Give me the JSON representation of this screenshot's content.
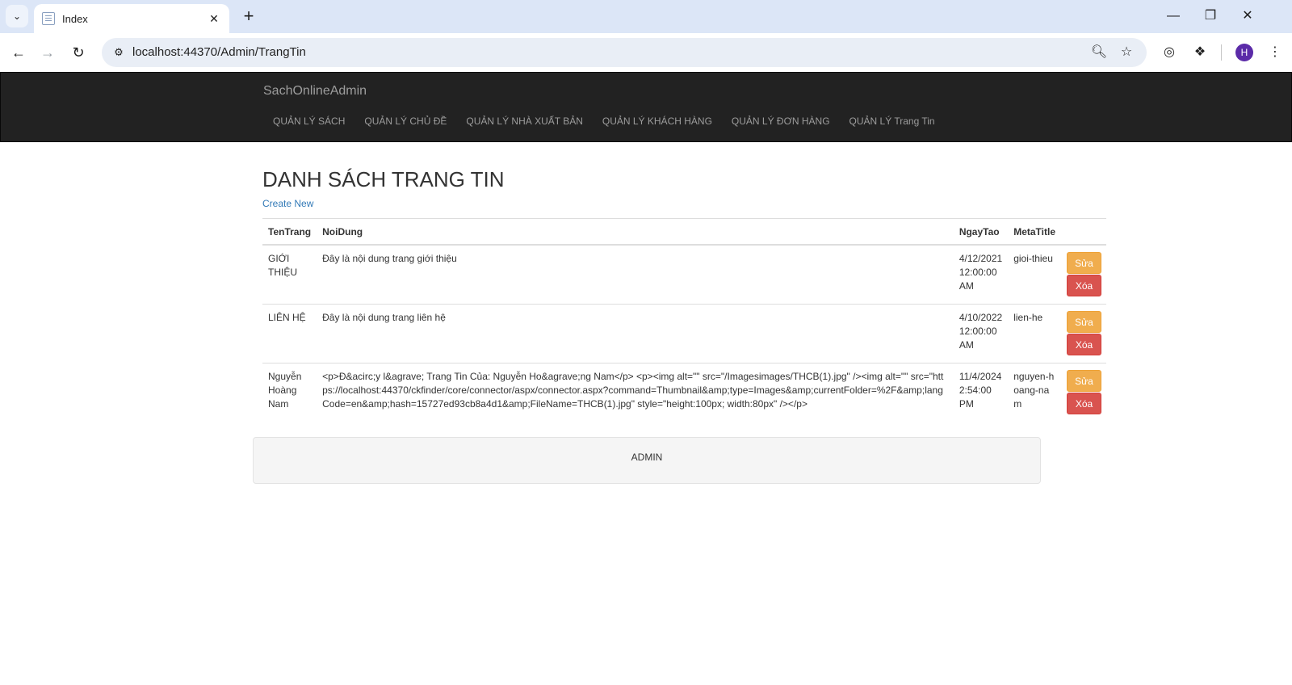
{
  "browser": {
    "tab_title": "Index",
    "url": "localhost:44370/Admin/TrangTin",
    "profile_initial": "H"
  },
  "navbar": {
    "brand": "SachOnlineAdmin",
    "menu": [
      "QUẢN LÝ SÁCH",
      "QUẢN LÝ CHỦ ĐỀ",
      "QUẢN LÝ NHÀ XUẤT BẢN",
      "QUẢN LÝ KHÁCH HÀNG",
      "QUẢN LÝ ĐƠN HÀNG",
      "QUẢN LÝ Trang Tin"
    ]
  },
  "page": {
    "title": "DANH SÁCH TRANG TIN",
    "create_link": "Create New"
  },
  "table": {
    "headers": {
      "ten": "TenTrang",
      "noidung": "NoiDung",
      "ngay": "NgayTao",
      "meta": "MetaTitle"
    },
    "rows": [
      {
        "ten": "GIỚI THIỆU",
        "noidung": "Đây là nội dung trang giới thiệu",
        "ngay": "4/12/2021 12:00:00 AM",
        "meta": "gioi-thieu",
        "edit": "Sửa",
        "delete": "Xóa"
      },
      {
        "ten": "LIÊN HỆ",
        "noidung": "Đây là nội dung trang liên hệ",
        "ngay": "4/10/2022 12:00:00 AM",
        "meta": "lien-he",
        "edit": "Sửa",
        "delete": "Xóa"
      },
      {
        "ten": "Nguyễn Hoàng Nam",
        "noidung": "<p>Đ&acirc;y l&agrave; Trang Tin Của: Nguyễn Ho&agrave;ng Nam</p> <p><img alt=\"\" src=\"/Imagesimages/THCB(1).jpg\" /><img alt=\"\" src=\"https://localhost:44370/ckfinder/core/connector/aspx/connector.aspx?command=Thumbnail&amp;type=Images&amp;currentFolder=%2F&amp;langCode=en&amp;hash=15727ed93cb8a4d1&amp;FileName=THCB(1).jpg\" style=\"height:100px; width:80px\" /></p>",
        "ngay": "11/4/2024 2:54:00 PM",
        "meta": "nguyen-hoang-nam",
        "edit": "Sửa",
        "delete": "Xóa"
      }
    ]
  },
  "footer": {
    "text": "ADMIN"
  },
  "colors": {
    "navbar_bg": "#222222",
    "link": "#337ab7",
    "warning": "#f0ad4e",
    "danger": "#d9534f"
  }
}
